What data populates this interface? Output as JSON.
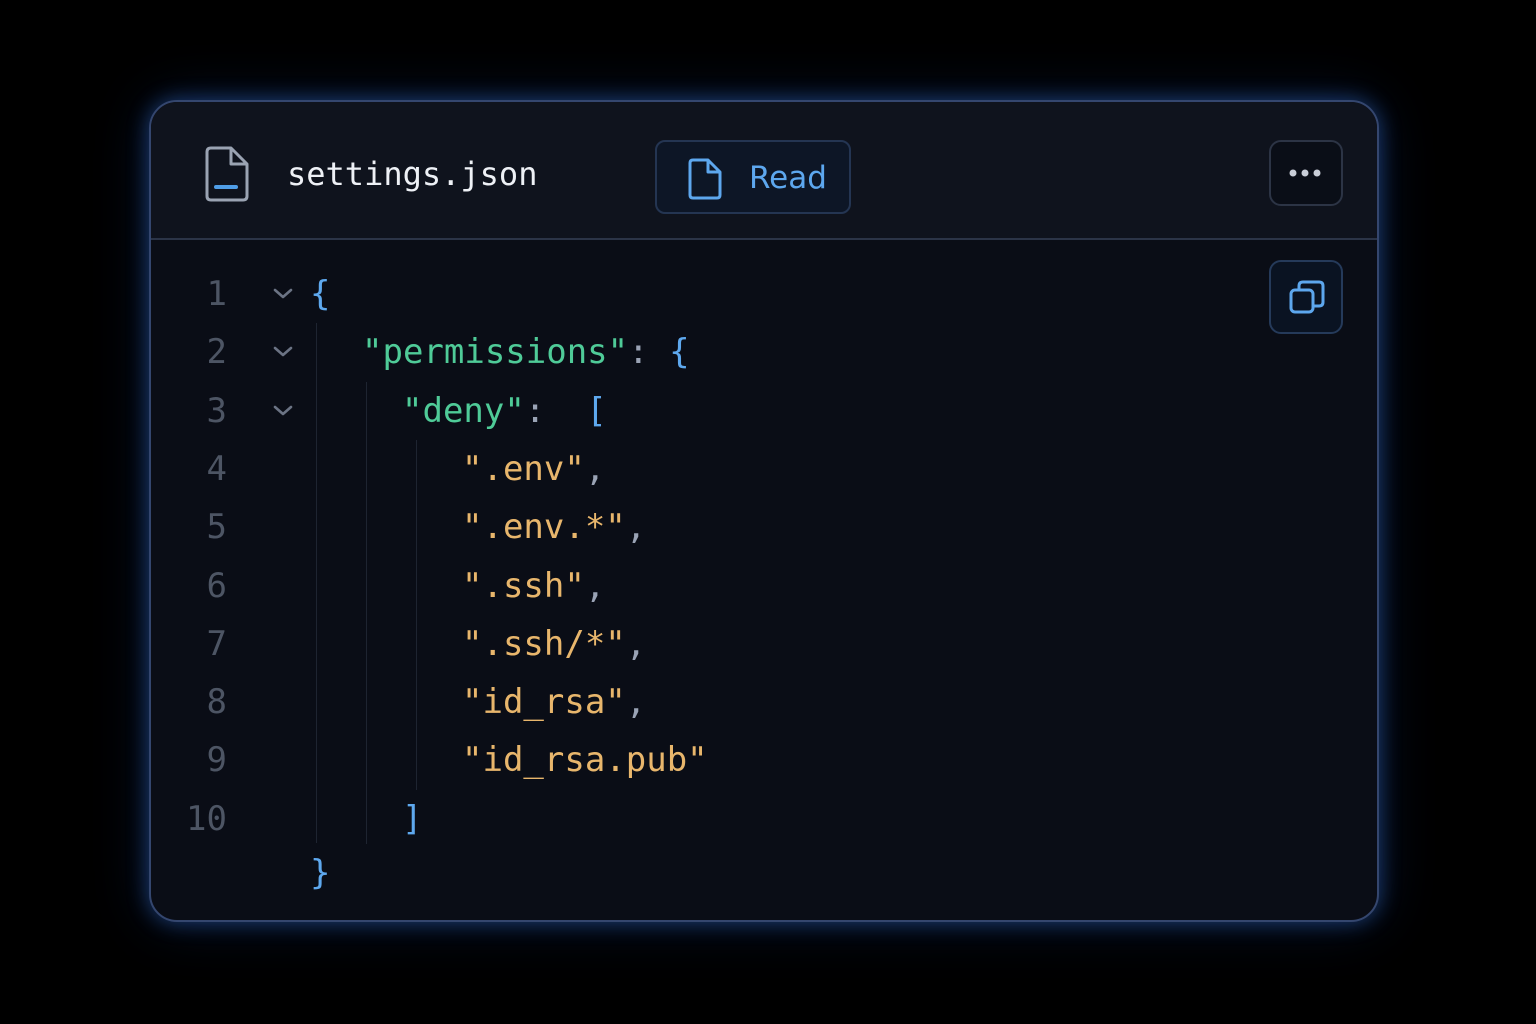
{
  "header": {
    "filename": "settings.json",
    "file_icon": "file-code-icon",
    "read_button": {
      "label": "Read",
      "icon": "file-icon"
    },
    "more_button": {
      "icon": "more-horizontal-icon"
    }
  },
  "copy_button": {
    "icon": "copy-icon"
  },
  "editor": {
    "lines": [
      {
        "number": "1",
        "foldable": true,
        "tokens": [
          {
            "text": "{",
            "kind": "brace"
          }
        ]
      },
      {
        "number": "2",
        "foldable": true,
        "tokens": [
          {
            "text": "\"permissions\"",
            "kind": "key"
          },
          {
            "text": ": ",
            "kind": "punct"
          },
          {
            "text": "{",
            "kind": "brace"
          }
        ]
      },
      {
        "number": "3",
        "foldable": true,
        "tokens": [
          {
            "text": "\"deny\"",
            "kind": "key"
          },
          {
            "text": ":  ",
            "kind": "punct"
          },
          {
            "text": "[",
            "kind": "brace"
          }
        ]
      },
      {
        "number": "4",
        "foldable": false,
        "tokens": [
          {
            "text": "\".env\"",
            "kind": "str"
          },
          {
            "text": ",",
            "kind": "punct"
          }
        ]
      },
      {
        "number": "5",
        "foldable": false,
        "tokens": [
          {
            "text": "\".env.*\"",
            "kind": "str"
          },
          {
            "text": ",",
            "kind": "punct"
          }
        ]
      },
      {
        "number": "6",
        "foldable": false,
        "tokens": [
          {
            "text": "\".ssh\"",
            "kind": "str"
          },
          {
            "text": ",",
            "kind": "punct"
          }
        ]
      },
      {
        "number": "7",
        "foldable": false,
        "tokens": [
          {
            "text": "\".ssh/*\"",
            "kind": "str"
          },
          {
            "text": ",",
            "kind": "punct"
          }
        ]
      },
      {
        "number": "8",
        "foldable": false,
        "tokens": [
          {
            "text": "\"id_rsa\"",
            "kind": "str"
          },
          {
            "text": ",",
            "kind": "punct"
          }
        ]
      },
      {
        "number": "9",
        "foldable": false,
        "tokens": [
          {
            "text": "\"id_rsa.pub\"",
            "kind": "str"
          }
        ]
      },
      {
        "number": "10",
        "foldable": false,
        "tokens": [
          {
            "text": "]",
            "kind": "brace"
          }
        ]
      },
      {
        "number": "",
        "foldable": false,
        "tokens": [
          {
            "text": "}",
            "kind": "brace"
          }
        ]
      }
    ]
  },
  "colors": {
    "brace": "#5ea8ee",
    "key": "#4fcb98",
    "string": "#e8b66c",
    "accent": "#5da7ee",
    "glow": "#3b82f6"
  }
}
